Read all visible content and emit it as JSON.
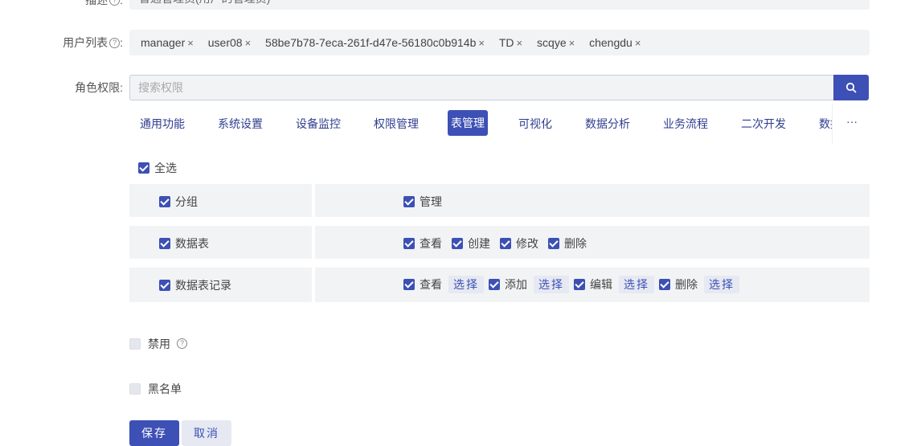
{
  "description": {
    "label": "描述",
    "value": "普通管理员(用户的管理员)"
  },
  "user_list": {
    "label": "用户列表",
    "tags": [
      "manager",
      "user08",
      "58be7b78-7eca-261f-d47e-56180c0b914b",
      "TD",
      "scqye",
      "chengdu"
    ]
  },
  "role_permissions": {
    "label": "角色权限",
    "search_placeholder": "搜索权限",
    "tabs": [
      "通用功能",
      "系统设置",
      "设备监控",
      "权限管理",
      "表管理",
      "可视化",
      "数据分析",
      "业务流程",
      "二次开发",
      "数据"
    ],
    "active_tab": "表管理",
    "more": "···",
    "select_all": "全选",
    "rows": [
      {
        "name": "分组",
        "perms": [
          {
            "label": "管理"
          }
        ]
      },
      {
        "name": "数据表",
        "perms": [
          {
            "label": "查看"
          },
          {
            "label": "创建"
          },
          {
            "label": "修改"
          },
          {
            "label": "删除"
          }
        ]
      },
      {
        "name": "数据表记录",
        "perms": [
          {
            "label": "查看",
            "action": "选择"
          },
          {
            "label": "添加",
            "action": "选择"
          },
          {
            "label": "编辑",
            "action": "选择"
          },
          {
            "label": "删除",
            "action": "选择"
          }
        ]
      }
    ]
  },
  "disable": {
    "label": "禁用"
  },
  "blacklist": {
    "label": "黑名单"
  },
  "buttons": {
    "save": "保存",
    "cancel": "取消"
  },
  "colors": {
    "primary": "#3d50b5",
    "field_bg": "#f2f3f5"
  }
}
